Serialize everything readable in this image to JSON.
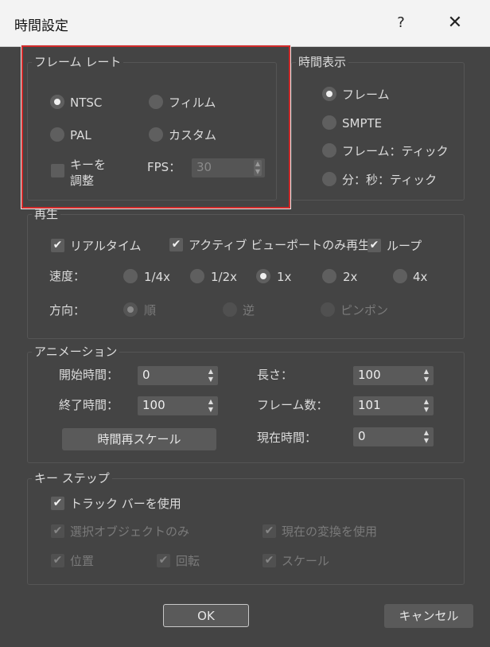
{
  "window": {
    "title": "時間設定",
    "help_glyph": "?",
    "close_glyph": "✕"
  },
  "frame_rate": {
    "title": "フレーム レート",
    "options": [
      {
        "label": "NTSC",
        "selected": true
      },
      {
        "label": "フィルム",
        "selected": false
      },
      {
        "label": "PAL",
        "selected": false
      },
      {
        "label": "カスタム",
        "selected": false
      }
    ],
    "adjust_keys": {
      "label_line1": "キーを",
      "label_line2": "調整",
      "checked": false
    },
    "fps": {
      "label": "FPS：",
      "value": "30"
    }
  },
  "time_display": {
    "title": "時間表示",
    "options": [
      {
        "label": "フレーム",
        "selected": true
      },
      {
        "label": "SMPTE",
        "selected": false
      },
      {
        "label": "フレーム：ティック",
        "selected": false
      },
      {
        "label": "分：秒：ティック",
        "selected": false
      }
    ]
  },
  "playback": {
    "title": "再生",
    "realtime": {
      "label": "リアルタイム",
      "checked": true
    },
    "active_viewport": {
      "label": "アクティブ ビューポートのみ再生",
      "checked": true
    },
    "loop": {
      "label": "ループ",
      "checked": true
    },
    "speed": {
      "label": "速度：",
      "options": [
        "1/4x",
        "1/2x",
        "1x",
        "2x",
        "4x"
      ],
      "selected": "1x"
    },
    "direction": {
      "label": "方向：",
      "options": [
        "順",
        "逆",
        "ピンポン"
      ],
      "selected": "順"
    }
  },
  "animation": {
    "title": "アニメーション",
    "start_time": {
      "label": "開始時間：",
      "value": "0"
    },
    "end_time": {
      "label": "終了時間：",
      "value": "100"
    },
    "length": {
      "label": "長さ：",
      "value": "100"
    },
    "frame_count": {
      "label": "フレーム数：",
      "value": "101"
    },
    "current_time": {
      "label": "現在時間：",
      "value": "0"
    },
    "rescale_button": "時間再スケール"
  },
  "key_steps": {
    "title": "キー ステップ",
    "use_trackbar": {
      "label": "トラック バーを使用",
      "checked": true
    },
    "selected_only": {
      "label": "選択オブジェクトのみ",
      "checked": true
    },
    "use_current_transform": {
      "label": "現在の変換を使用",
      "checked": true
    },
    "position": {
      "label": "位置",
      "checked": true
    },
    "rotation": {
      "label": "回転",
      "checked": true
    },
    "scale": {
      "label": "スケール",
      "checked": true
    }
  },
  "buttons": {
    "ok": "OK",
    "cancel": "キャンセル"
  },
  "glyphs": {
    "check": "✔",
    "spin_up": "▲",
    "spin_down": "▼"
  }
}
